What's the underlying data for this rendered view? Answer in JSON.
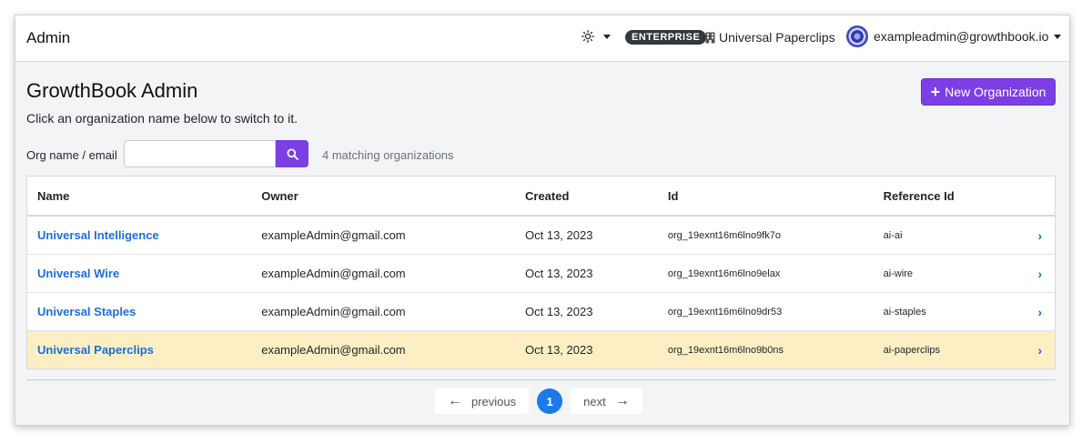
{
  "header": {
    "app_title": "Admin",
    "theme_icon": "sun-icon",
    "plan_badge": "ENTERPRISE",
    "org_name": "Universal Paperclips",
    "org_icon": "building-icon",
    "user_email": "exampleadmin@growthbook.io"
  },
  "page": {
    "title": "GrowthBook Admin",
    "subtitle": "Click an organization name below to switch to it.",
    "new_org_button": "New Organization",
    "accent_color": "#7b3fe4",
    "link_color": "#1a6fd6"
  },
  "search": {
    "label": "Org name / email",
    "value": "",
    "placeholder": "",
    "match_count": "4 matching organizations"
  },
  "table": {
    "columns": [
      "Name",
      "Owner",
      "Created",
      "Id",
      "Reference Id"
    ],
    "rows": [
      {
        "name": "Universal Intelligence",
        "owner": "exampleAdmin@gmail.com",
        "created": "Oct 13, 2023",
        "id": "org_19exnt16m6lno9fk7o",
        "ref": "ai-ai",
        "current": false
      },
      {
        "name": "Universal Wire",
        "owner": "exampleAdmin@gmail.com",
        "created": "Oct 13, 2023",
        "id": "org_19exnt16m6lno9elax",
        "ref": "ai-wire",
        "current": false
      },
      {
        "name": "Universal Staples",
        "owner": "exampleAdmin@gmail.com",
        "created": "Oct 13, 2023",
        "id": "org_19exnt16m6lno9dr53",
        "ref": "ai-staples",
        "current": false
      },
      {
        "name": "Universal Paperclips",
        "owner": "exampleAdmin@gmail.com",
        "created": "Oct 13, 2023",
        "id": "org_19exnt16m6lno9b0ns",
        "ref": "ai-paperclips",
        "current": true
      }
    ]
  },
  "pagination": {
    "previous": "previous",
    "current_page": "1",
    "next": "next"
  }
}
